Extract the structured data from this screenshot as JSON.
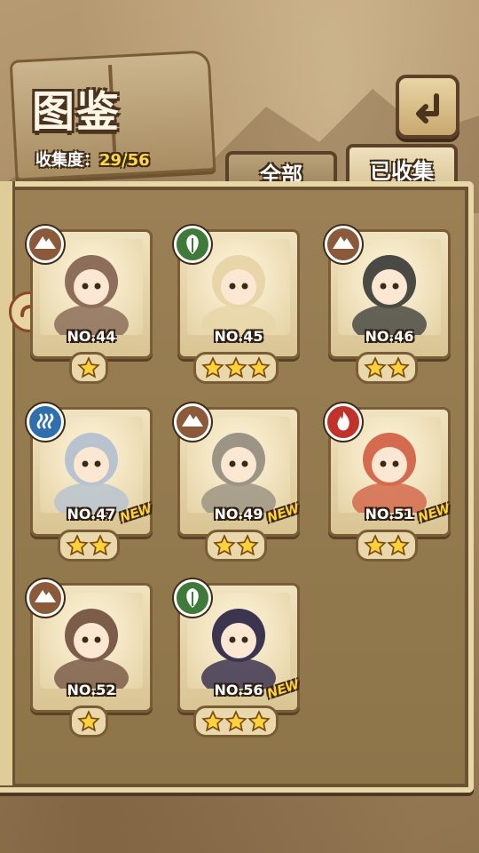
{
  "header": {
    "title": "图鉴",
    "collection_label": "收集度：",
    "collection_value": "29/56"
  },
  "tabs": [
    {
      "label": "全部",
      "active": false
    },
    {
      "label": "已收集",
      "active": true
    }
  ],
  "elements": {
    "earth": {
      "color": "#8a5a3a",
      "icon": "mountain-icon"
    },
    "nature": {
      "color": "#3f7a3a",
      "icon": "leaf-icon"
    },
    "water": {
      "color": "#2f6fae",
      "icon": "waves-icon"
    },
    "fire": {
      "color": "#c0322a",
      "icon": "flame-icon"
    }
  },
  "cards": [
    {
      "number": "NO.44",
      "stars": 1,
      "element": "earth",
      "new": false,
      "new_label": ""
    },
    {
      "number": "NO.45",
      "stars": 3,
      "element": "nature",
      "new": false,
      "new_label": ""
    },
    {
      "number": "NO.46",
      "stars": 2,
      "element": "earth",
      "new": false,
      "new_label": ""
    },
    {
      "number": "NO.47",
      "stars": 2,
      "element": "water",
      "new": true,
      "new_label": "NEW"
    },
    {
      "number": "NO.49",
      "stars": 2,
      "element": "earth",
      "new": true,
      "new_label": "NEW"
    },
    {
      "number": "NO.51",
      "stars": 2,
      "element": "fire",
      "new": true,
      "new_label": "NEW"
    },
    {
      "number": "NO.52",
      "stars": 1,
      "element": "earth",
      "new": false,
      "new_label": ""
    },
    {
      "number": "NO.56",
      "stars": 3,
      "element": "nature",
      "new": true,
      "new_label": "NEW"
    }
  ]
}
